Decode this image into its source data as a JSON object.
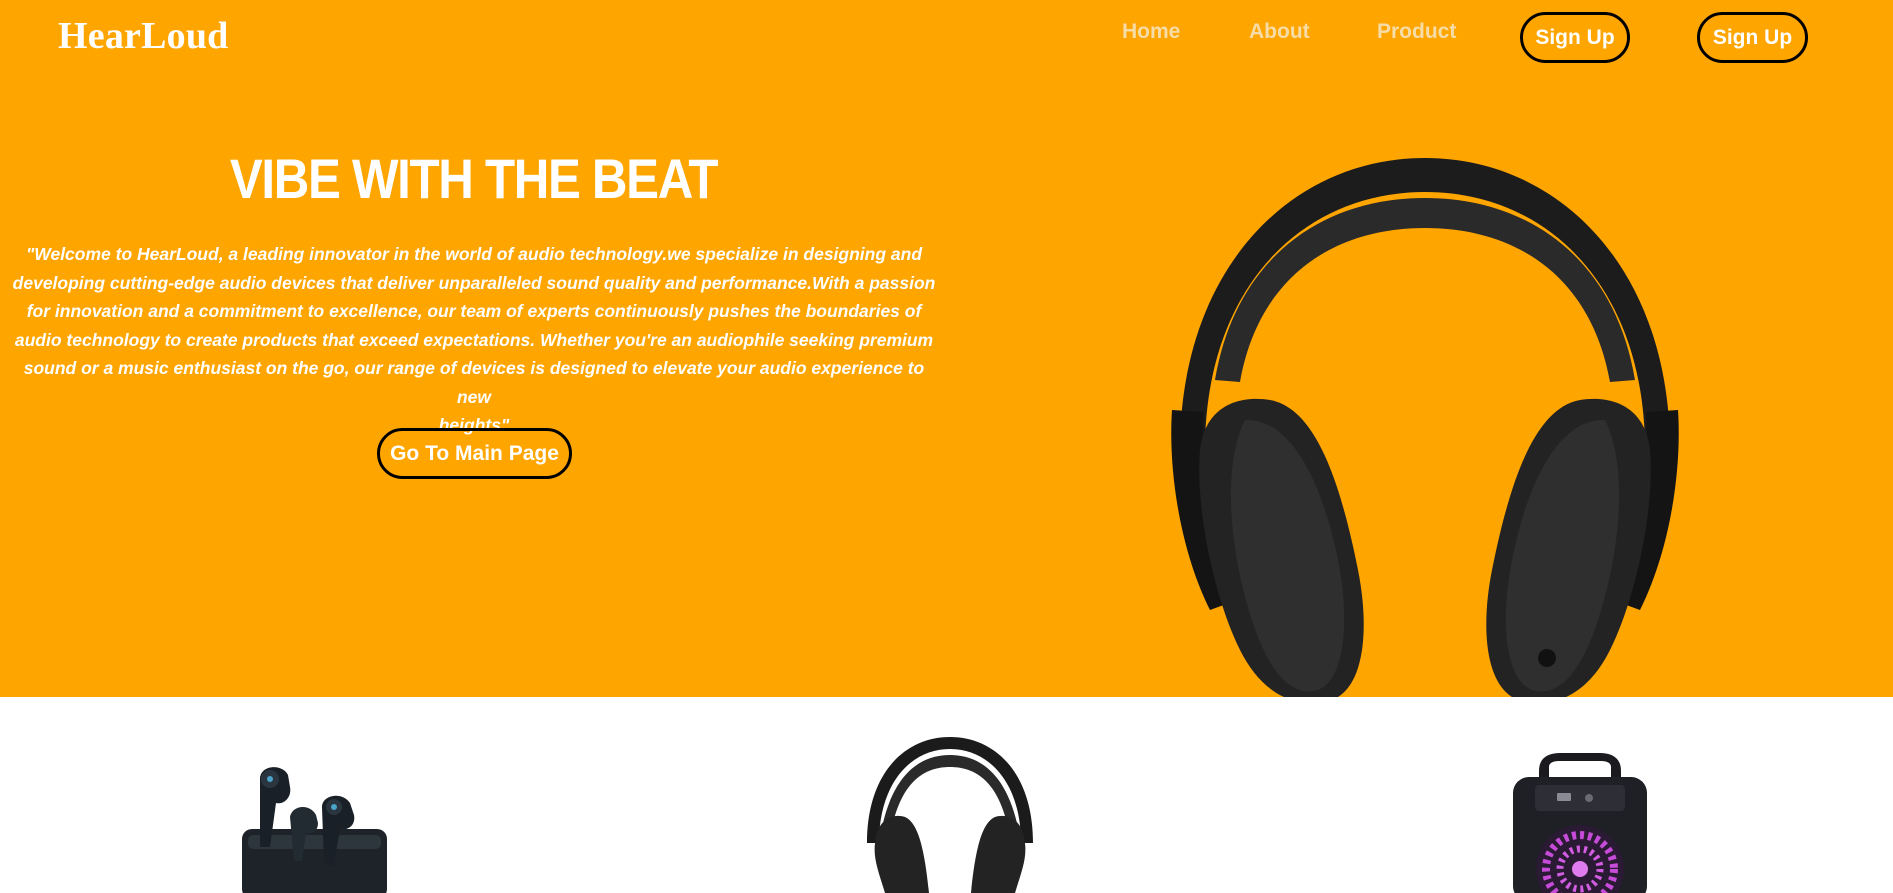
{
  "brand": "HearLoud",
  "nav": {
    "home": "Home",
    "about": "About",
    "product": "Product",
    "signup_1": "Sign Up",
    "signup_2": "Sign Up"
  },
  "hero": {
    "headline": "VIBE WITH THE BEAT",
    "intro_lines": [
      "\"Welcome to HearLoud, a leading innovator in the world of audio technology.we specialize in designing and",
      "developing cutting-edge audio devices that deliver unparalleled sound quality and performance.With a passion",
      "for innovation and a commitment to excellence, our team of experts continuously pushes the boundaries of",
      "audio technology to create products that exceed expectations. Whether you're an audiophile seeking premium",
      "sound or a music enthusiast on the go, our range of devices is designed to elevate your audio experience to new",
      "heights\""
    ],
    "cta": "Go To Main Page"
  },
  "colors": {
    "hero_bg": "#FFA500",
    "text": "#FFFFFF",
    "nav_link": "#F6DCA6",
    "button_border": "#000000"
  },
  "images": {
    "hero": "over-ear-headphones-image",
    "products": [
      "wireless-earbuds-image",
      "headset-image",
      "party-speaker-image"
    ]
  }
}
